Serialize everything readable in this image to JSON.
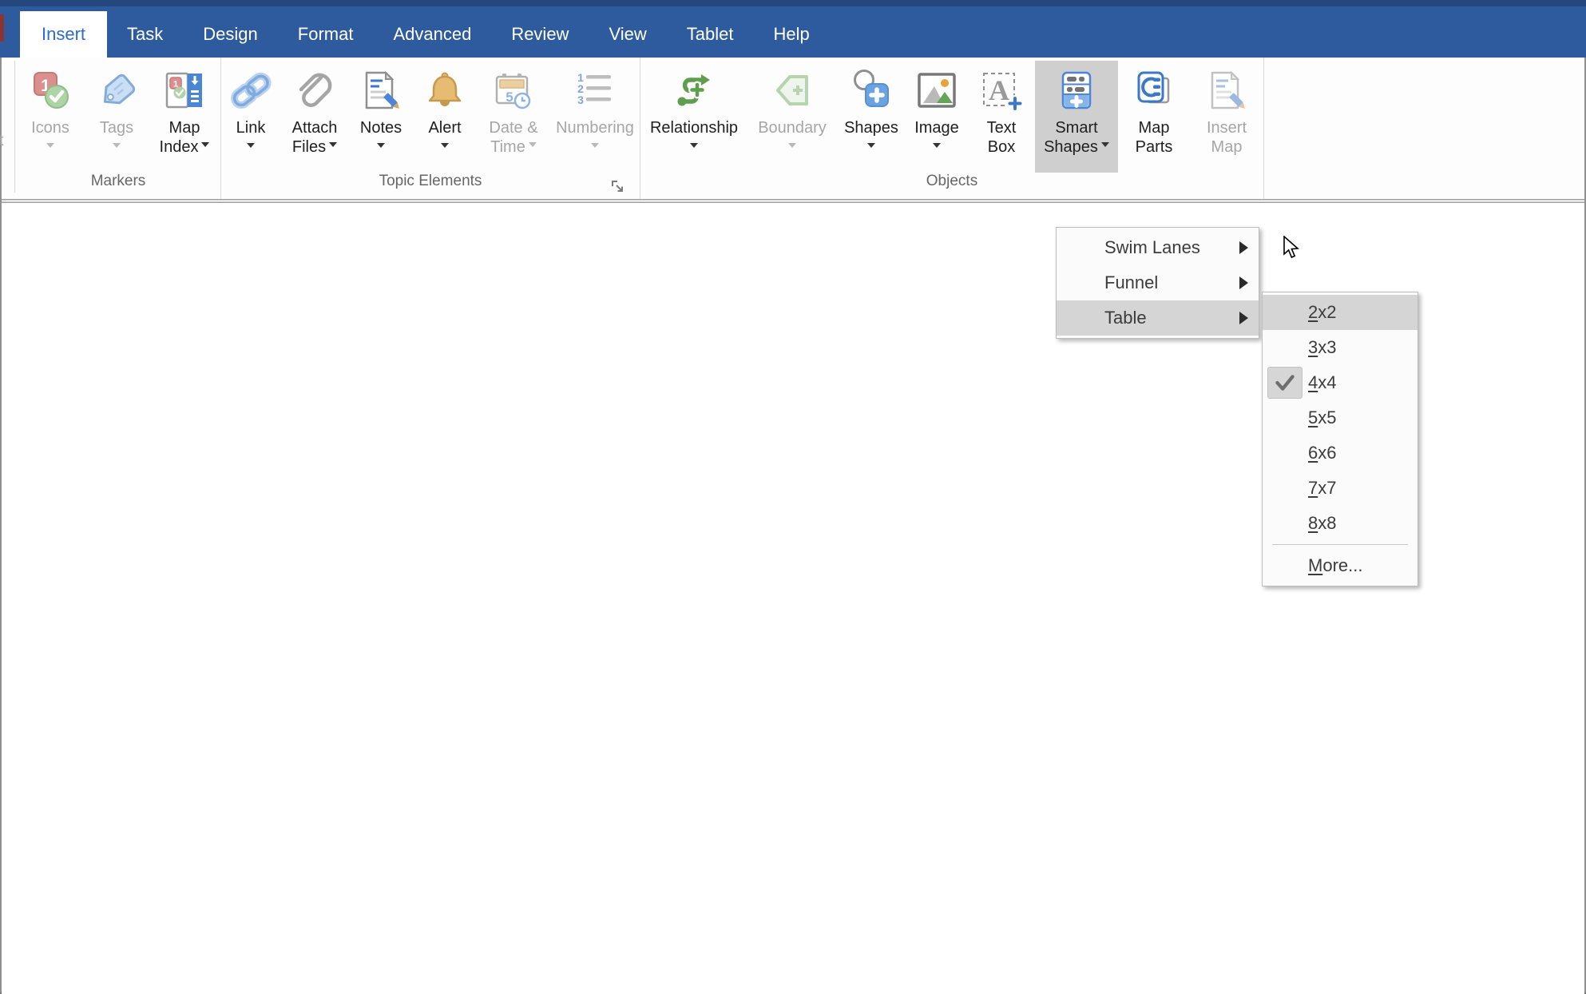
{
  "window": {
    "edge_fragment_text": "t"
  },
  "tabs": {
    "insert": "Insert",
    "task": "Task",
    "design": "Design",
    "format": "Format",
    "advanced": "Advanced",
    "review": "Review",
    "view": "View",
    "tablet": "Tablet",
    "help": "Help"
  },
  "groups": {
    "markers": "Markers",
    "topic": "Topic Elements",
    "objects": "Objects"
  },
  "buttons": {
    "icons": {
      "l1": "Icons",
      "disabled": true
    },
    "tags": {
      "l1": "Tags",
      "disabled": true
    },
    "map_index": {
      "l1": "Map",
      "l2": "Index",
      "disabled": false
    },
    "link": {
      "l1": "Link",
      "disabled": false
    },
    "attach_files": {
      "l1": "Attach",
      "l2": "Files",
      "disabled": false
    },
    "notes": {
      "l1": "Notes",
      "disabled": false
    },
    "alert": {
      "l1": "Alert",
      "disabled": false
    },
    "date_time": {
      "l1": "Date &",
      "l2": "Time",
      "disabled": true
    },
    "numbering": {
      "l1": "Numbering",
      "disabled": true
    },
    "relationship": {
      "l1": "Relationship",
      "disabled": false
    },
    "boundary": {
      "l1": "Boundary",
      "disabled": true
    },
    "shapes": {
      "l1": "Shapes",
      "disabled": false
    },
    "image": {
      "l1": "Image",
      "disabled": false
    },
    "text_box": {
      "l1": "Text",
      "l2": "Box",
      "disabled": false
    },
    "smart_shapes": {
      "l1": "Smart",
      "l2": "Shapes",
      "pressed": true
    },
    "map_parts": {
      "l1": "Map",
      "l2": "Parts",
      "disabled": false
    },
    "insert_map": {
      "l1": "Insert",
      "l2": "Map",
      "disabled": true
    }
  },
  "smart_shapes_menu": {
    "swim_lanes": "Swim Lanes",
    "funnel": "Funnel",
    "table": "Table",
    "highlighted_item": "Table"
  },
  "table_submenu": {
    "s2": {
      "c": "2",
      "rest": "x2"
    },
    "s3": {
      "c": "3",
      "rest": "x3"
    },
    "s4": {
      "c": "4",
      "rest": "x4"
    },
    "s5": {
      "c": "5",
      "rest": "x5"
    },
    "s6": {
      "c": "6",
      "rest": "x6"
    },
    "s7": {
      "c": "7",
      "rest": "x7"
    },
    "s8": {
      "c": "8",
      "rest": "x8"
    },
    "more": {
      "c": "M",
      "rest": "ore..."
    },
    "checked_item": "4x4",
    "highlighted_item": "2x2"
  },
  "icon_glyphs": {
    "one": "1",
    "two": "2",
    "three": "3",
    "five": "5",
    "a": "A"
  },
  "colors": {
    "titlebar": "#2e5b9e",
    "titlebar_top": "#24487e",
    "active_tab_text": "#2b6bd5",
    "pressed_button_bg": "#cfcfcf",
    "menu_highlight": "#d5d5d5",
    "disabled_text": "#a6a6a6",
    "label_text": "#1f1f1f",
    "group_label_text": "#666666"
  }
}
